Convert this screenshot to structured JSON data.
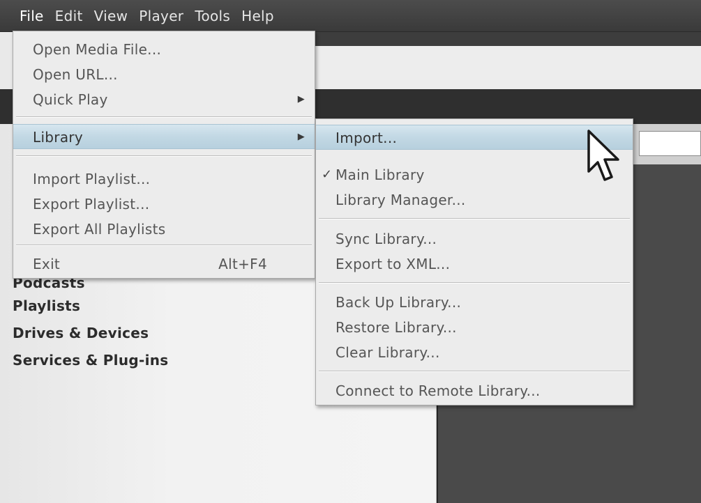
{
  "menubar": {
    "items": [
      "File",
      "Edit",
      "View",
      "Player",
      "Tools",
      "Help"
    ]
  },
  "sidebar": {
    "items": [
      "Podcasts",
      "Playlists",
      "Drives & Devices",
      "Services & Plug-ins"
    ]
  },
  "file_menu": {
    "open_media_file": "Open Media File...",
    "open_url": "Open URL...",
    "quick_play": "Quick Play",
    "library": "Library",
    "import_playlist": "Import Playlist...",
    "export_playlist": "Export Playlist...",
    "export_all_playlists": "Export All Playlists",
    "exit": "Exit",
    "exit_accel": "Alt+F4"
  },
  "library_menu": {
    "import": "Import...",
    "main_library": "Main Library",
    "main_library_check": "✓",
    "library_manager": "Library Manager...",
    "sync_library": "Sync Library...",
    "export_to_xml": "Export to XML...",
    "back_up_library": "Back Up Library...",
    "restore_library": "Restore Library...",
    "clear_library": "Clear Library...",
    "connect_to_remote_library": "Connect to Remote Library..."
  },
  "icons": {
    "submenu_arrow": "▶",
    "cursor": "mouse-pointer-icon"
  },
  "colors": {
    "menubar_bg": "#424242",
    "menu_bg": "#ececec",
    "highlight": "#c2d8e4"
  }
}
